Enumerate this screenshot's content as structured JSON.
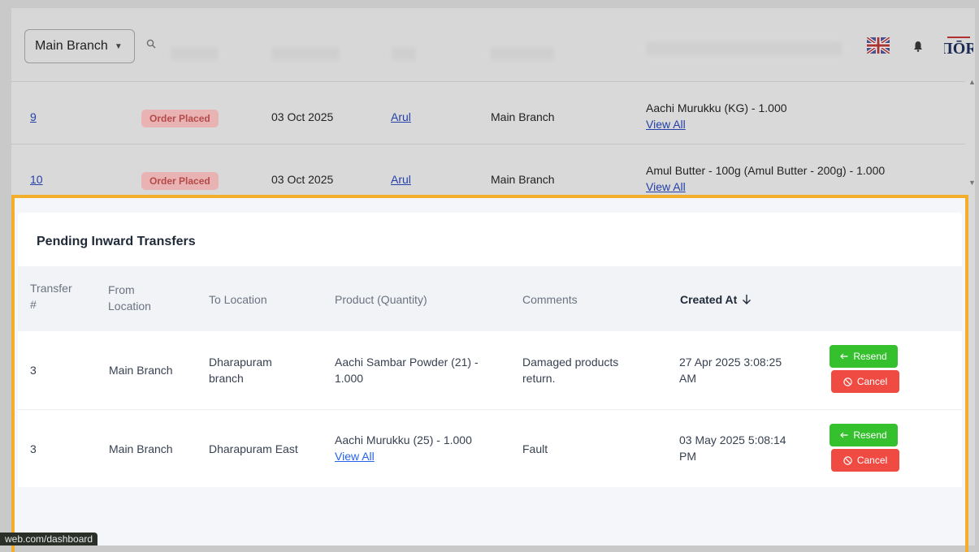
{
  "header": {
    "branch_select": "Main Branch",
    "language_flag": "uk-flag-icon",
    "icons": [
      "search-icon",
      "bell-icon",
      "logo-icon"
    ]
  },
  "background_orders": {
    "rows": [
      {
        "id": "9",
        "status": "Order Placed",
        "date": "03 Oct 2025",
        "user": "Arul",
        "branch": "Main Branch",
        "product": "Aachi Murukku (KG) - 1.000",
        "link": "View All"
      },
      {
        "id": "10",
        "status": "Order Placed",
        "date": "03 Oct 2025",
        "user": "Arul",
        "branch": "Main Branch",
        "product": "Amul Butter - 100g (Amul Butter - 200g) - 1.000",
        "link": "View All"
      }
    ]
  },
  "panel": {
    "title": "Pending Inward Transfers",
    "columns": {
      "transfer_l1": "Transfer",
      "transfer_l2": "#",
      "from_l1": "From",
      "from_l2": "Location",
      "to": "To Location",
      "product": "Product (Quantity)",
      "comments": "Comments",
      "created": "Created At"
    },
    "rows": [
      {
        "transfer": "3",
        "from": "Main Branch",
        "to_l1": "Dharapuram",
        "to_l2": "branch",
        "product_l1": "Aachi Sambar Powder (21) -",
        "product_l2": "1.000",
        "comments_l1": "Damaged products",
        "comments_l2": "return.",
        "created_l1": "27 Apr 2025 3:08:25",
        "created_l2": "AM",
        "resend": "Resend",
        "cancel": "Cancel"
      },
      {
        "transfer": "3",
        "from": "Main Branch",
        "to": "Dharapuram East",
        "product": "Aachi Murukku (25) - 1.000",
        "product_link": "View All",
        "comments": "Fault",
        "created_l1": "03 May 2025 5:08:14",
        "created_l2": "PM",
        "resend": "Resend",
        "cancel": "Cancel"
      }
    ]
  },
  "status_url": "web.com/dashboard",
  "colors": {
    "highlight": "#f3ae2b",
    "resend": "#35c02d",
    "cancel": "#f04b43",
    "link": "#2563eb"
  }
}
